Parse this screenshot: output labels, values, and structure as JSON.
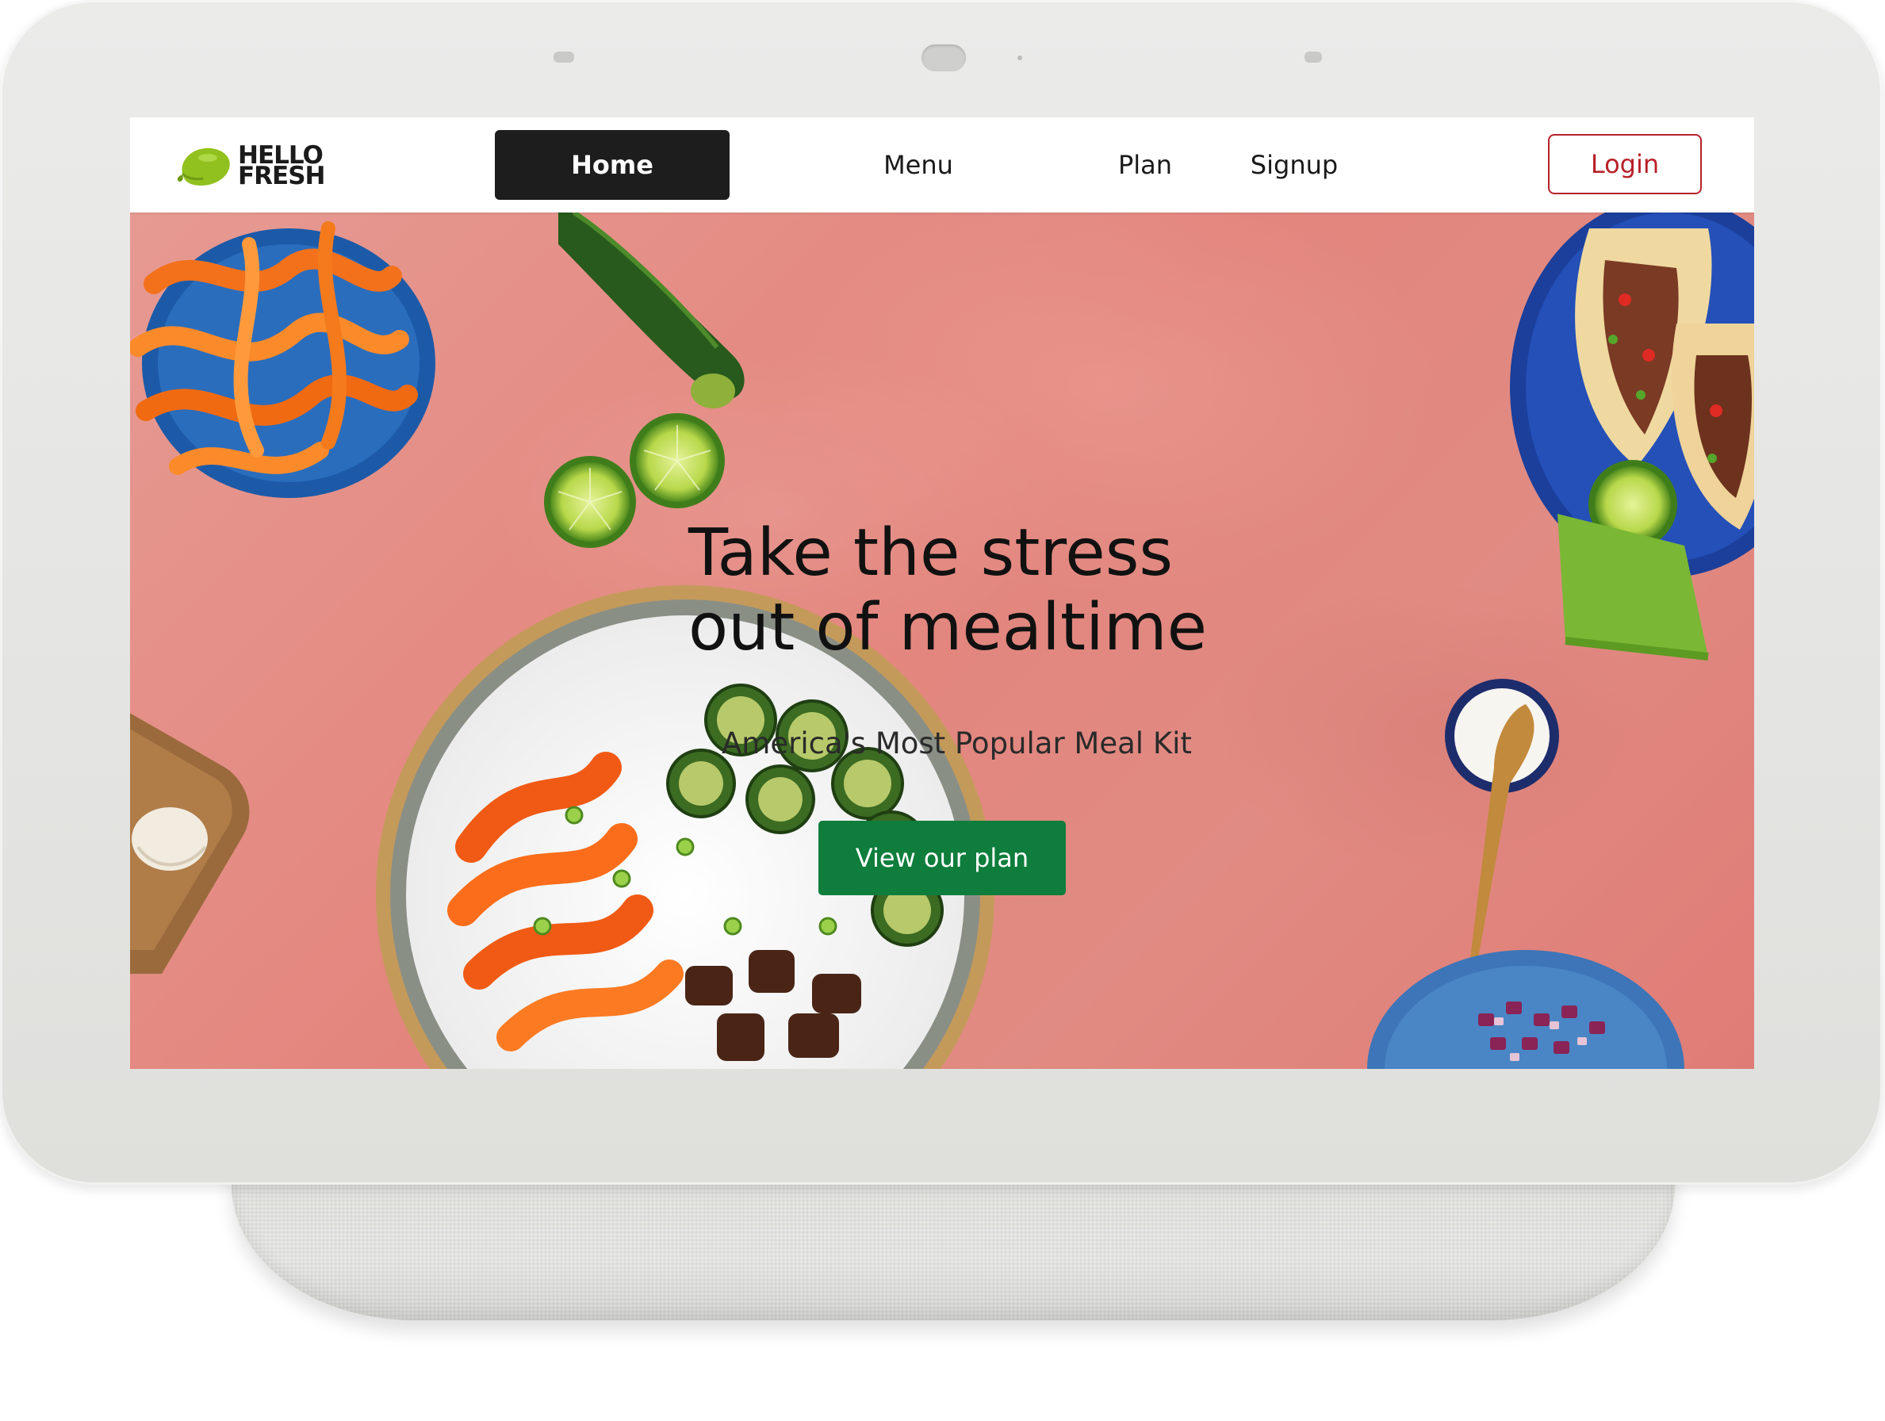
{
  "brand": {
    "line1": "HELLO",
    "line2": "FRESH"
  },
  "nav": {
    "items": [
      {
        "label": "Home",
        "active": true
      },
      {
        "label": "Menu",
        "active": false
      },
      {
        "label": "Plan",
        "active": false
      },
      {
        "label": "Signup",
        "active": false
      }
    ],
    "login_label": "Login"
  },
  "hero": {
    "title_line1": "Take the stress",
    "title_line2": "out of mealtime",
    "subtitle": "America's Most Popular Meal Kit",
    "cta_label": "View our plan"
  },
  "colors": {
    "brand_green": "#91c11e",
    "cta_green": "#0f7d3c",
    "login_red": "#b7222a",
    "hero_background": "#e3857d",
    "active_nav": "#1d1d1d"
  }
}
